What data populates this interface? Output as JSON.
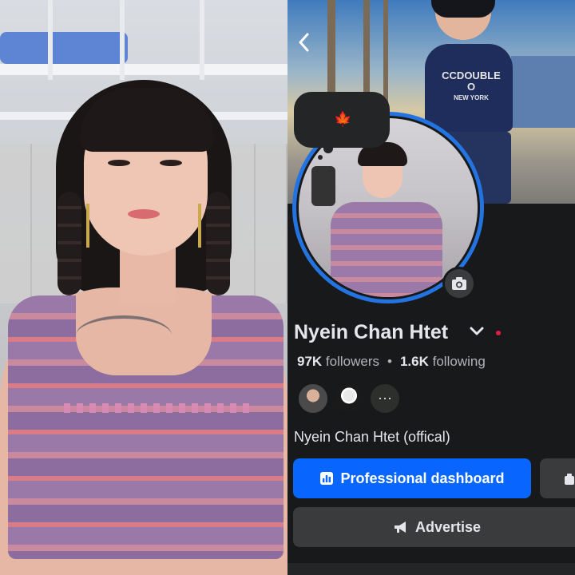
{
  "profile": {
    "name": "Nyein Chan Htet",
    "followers_count": "97K",
    "followers_label": "followers",
    "following_count": "1.6K",
    "following_label": "following",
    "separator": "•",
    "bio": "Nyein Chan Htet (offical)"
  },
  "cover": {
    "shirt_text_line1": "CCDOUBLE O",
    "shirt_text_line2": "NEW YORK"
  },
  "buttons": {
    "professional_dashboard": "Professional dashboard",
    "advertise": "Advertise"
  },
  "icons": {
    "back": "chevron-left-icon",
    "note": "maple-leaf-icon",
    "camera": "camera-icon",
    "name_dropdown": "chevron-down-icon",
    "dashboard": "bar-chart-icon",
    "advertise": "megaphone-icon"
  },
  "colors": {
    "background": "#18191a",
    "primary_button": "#0866ff",
    "secondary_button": "#3a3b3c",
    "avatar_ring": "#2374e1",
    "status_dot": "#e41e3f"
  }
}
